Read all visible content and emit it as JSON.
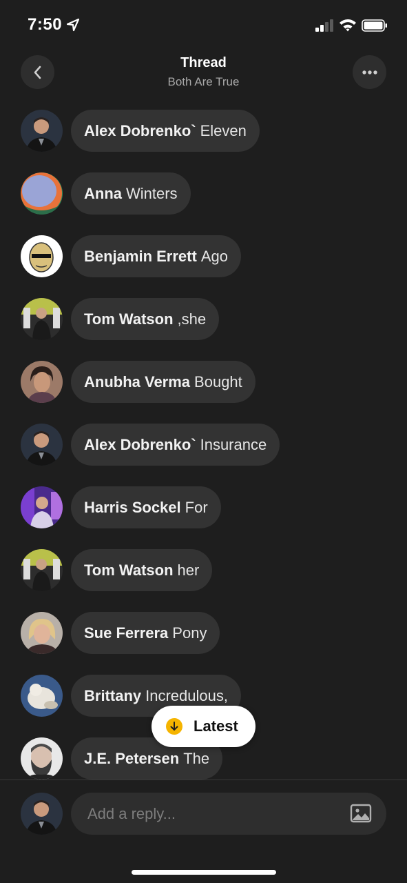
{
  "status_bar": {
    "time": "7:50"
  },
  "header": {
    "title": "Thread",
    "subtitle": "Both Are True"
  },
  "messages": [
    {
      "name": "Alex Dobrenko`",
      "text": "Eleven",
      "avatar": "alex"
    },
    {
      "name": "Anna",
      "text": "Winters",
      "avatar": "anna"
    },
    {
      "name": "Benjamin Errett",
      "text": "Ago",
      "avatar": "benjamin"
    },
    {
      "name": "Tom Watson",
      "text": ",she",
      "avatar": "tom"
    },
    {
      "name": "Anubha Verma",
      "text": "Bought",
      "avatar": "anubha"
    },
    {
      "name": "Alex Dobrenko`",
      "text": "Insurance",
      "avatar": "alex"
    },
    {
      "name": "Harris Sockel",
      "text": "For",
      "avatar": "harris"
    },
    {
      "name": "Tom Watson",
      "text": "her",
      "avatar": "tom"
    },
    {
      "name": "Sue Ferrera",
      "text": "Pony",
      "avatar": "sue"
    },
    {
      "name": "Brittany",
      "text": "Incredulous,",
      "avatar": "brittany"
    },
    {
      "name": "J.E. Petersen",
      "text": "The",
      "avatar": "je"
    }
  ],
  "latest_button": {
    "label": "Latest",
    "icon": "arrow-down-icon",
    "icon_color": "#f5b400"
  },
  "reply": {
    "placeholder": "Add a reply..."
  },
  "colors": {
    "background": "#1e1e1e",
    "bubble": "#333333",
    "accent": "#f5b400"
  }
}
